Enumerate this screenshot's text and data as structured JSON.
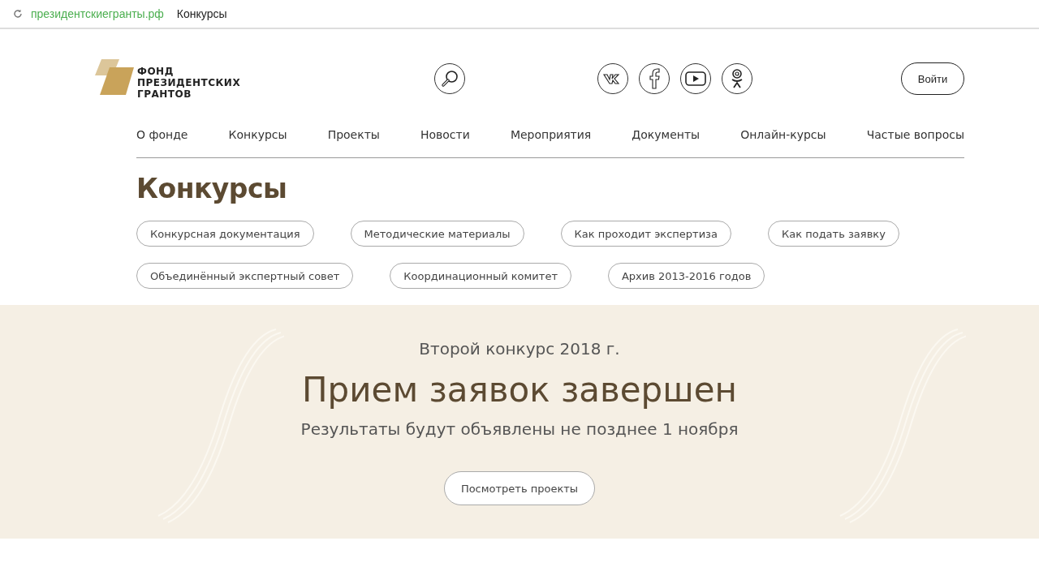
{
  "browser": {
    "domain": "президентскиегранты.рф",
    "page_title": "Конкурсы"
  },
  "logo": {
    "lines": [
      "ФОНД",
      "ПРЕЗИДЕНТСКИХ",
      "ГРАНТОВ"
    ]
  },
  "login_button": "Войти",
  "nav": [
    "О фонде",
    "Конкурсы",
    "Проекты",
    "Новости",
    "Мероприятия",
    "Документы",
    "Онлайн-курсы",
    "Частые вопросы"
  ],
  "page_title": "Конкурсы",
  "tags": [
    [
      "Конкурсная документация",
      "Методические материалы",
      "Как проходит экспертиза",
      "Как подать заявку"
    ],
    [
      "Объединённый экспертный совет",
      "Координационный комитет",
      "Архив 2013-2016 годов"
    ]
  ],
  "banner": {
    "kicker": "Второй конкурс 2018 г.",
    "title": "Прием заявок завершен",
    "subtitle": "Результаты будут объявлены не позднее 1 ноября",
    "button": "Посмотреть проекты"
  }
}
